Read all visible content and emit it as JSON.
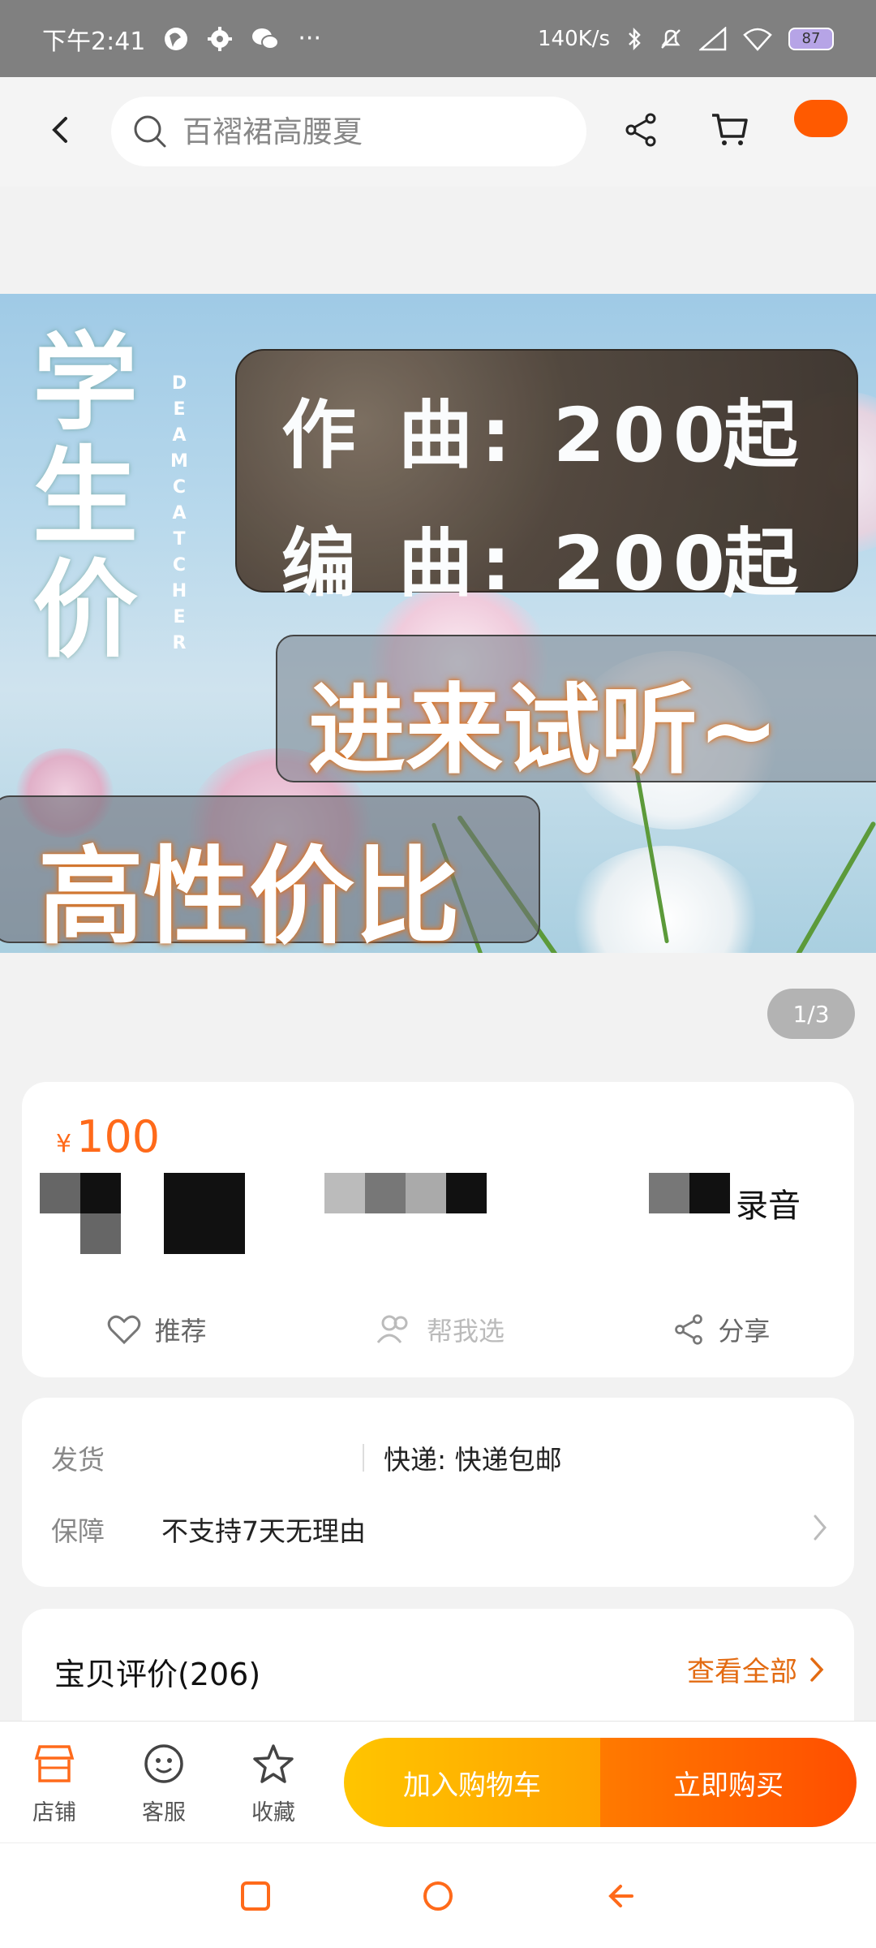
{
  "status_bar": {
    "time": "下午2:41",
    "more": "···",
    "net_speed": "140K/s",
    "battery": "87"
  },
  "search": {
    "placeholder": "百褶裙高腰夏"
  },
  "banner": {
    "vertical_title": [
      "学",
      "生",
      "价"
    ],
    "vertical_letters": [
      "D",
      "E",
      "A",
      "M",
      "C",
      "A",
      "T",
      "C",
      "H",
      "E",
      "R"
    ],
    "line1": "作 曲: 200",
    "line1_suffix": "起",
    "line2": "编 曲: 200",
    "line2_suffix": "起",
    "pill1": "进来试听~",
    "pill2": "高性价比"
  },
  "page_indicator": "1/3",
  "product": {
    "currency": "¥",
    "price": "100",
    "title_tail": "录音",
    "actions": [
      {
        "label": "推荐",
        "icon": "heart-icon"
      },
      {
        "label": "帮我选",
        "icon": "people-icon"
      },
      {
        "label": "分享",
        "icon": "share-icon"
      }
    ]
  },
  "shipping": {
    "ship_label": "发货",
    "ship_value": "快递: 快递包邮",
    "guarantee_label": "保障",
    "guarantee_value": "不支持7天无理由"
  },
  "review": {
    "title": "宝贝评价(206)",
    "link": "查看全部"
  },
  "bottom_bar": {
    "tabs": [
      {
        "label": "店铺",
        "icon": "store-icon"
      },
      {
        "label": "客服",
        "icon": "service-icon"
      },
      {
        "label": "收藏",
        "icon": "star-icon"
      }
    ],
    "add_to_cart": "加入购物车",
    "buy_now": "立即购买"
  },
  "colors": {
    "accent": "#ff6a1a",
    "cart_button": "#ffb300",
    "buy_button": "#ff5a00"
  }
}
